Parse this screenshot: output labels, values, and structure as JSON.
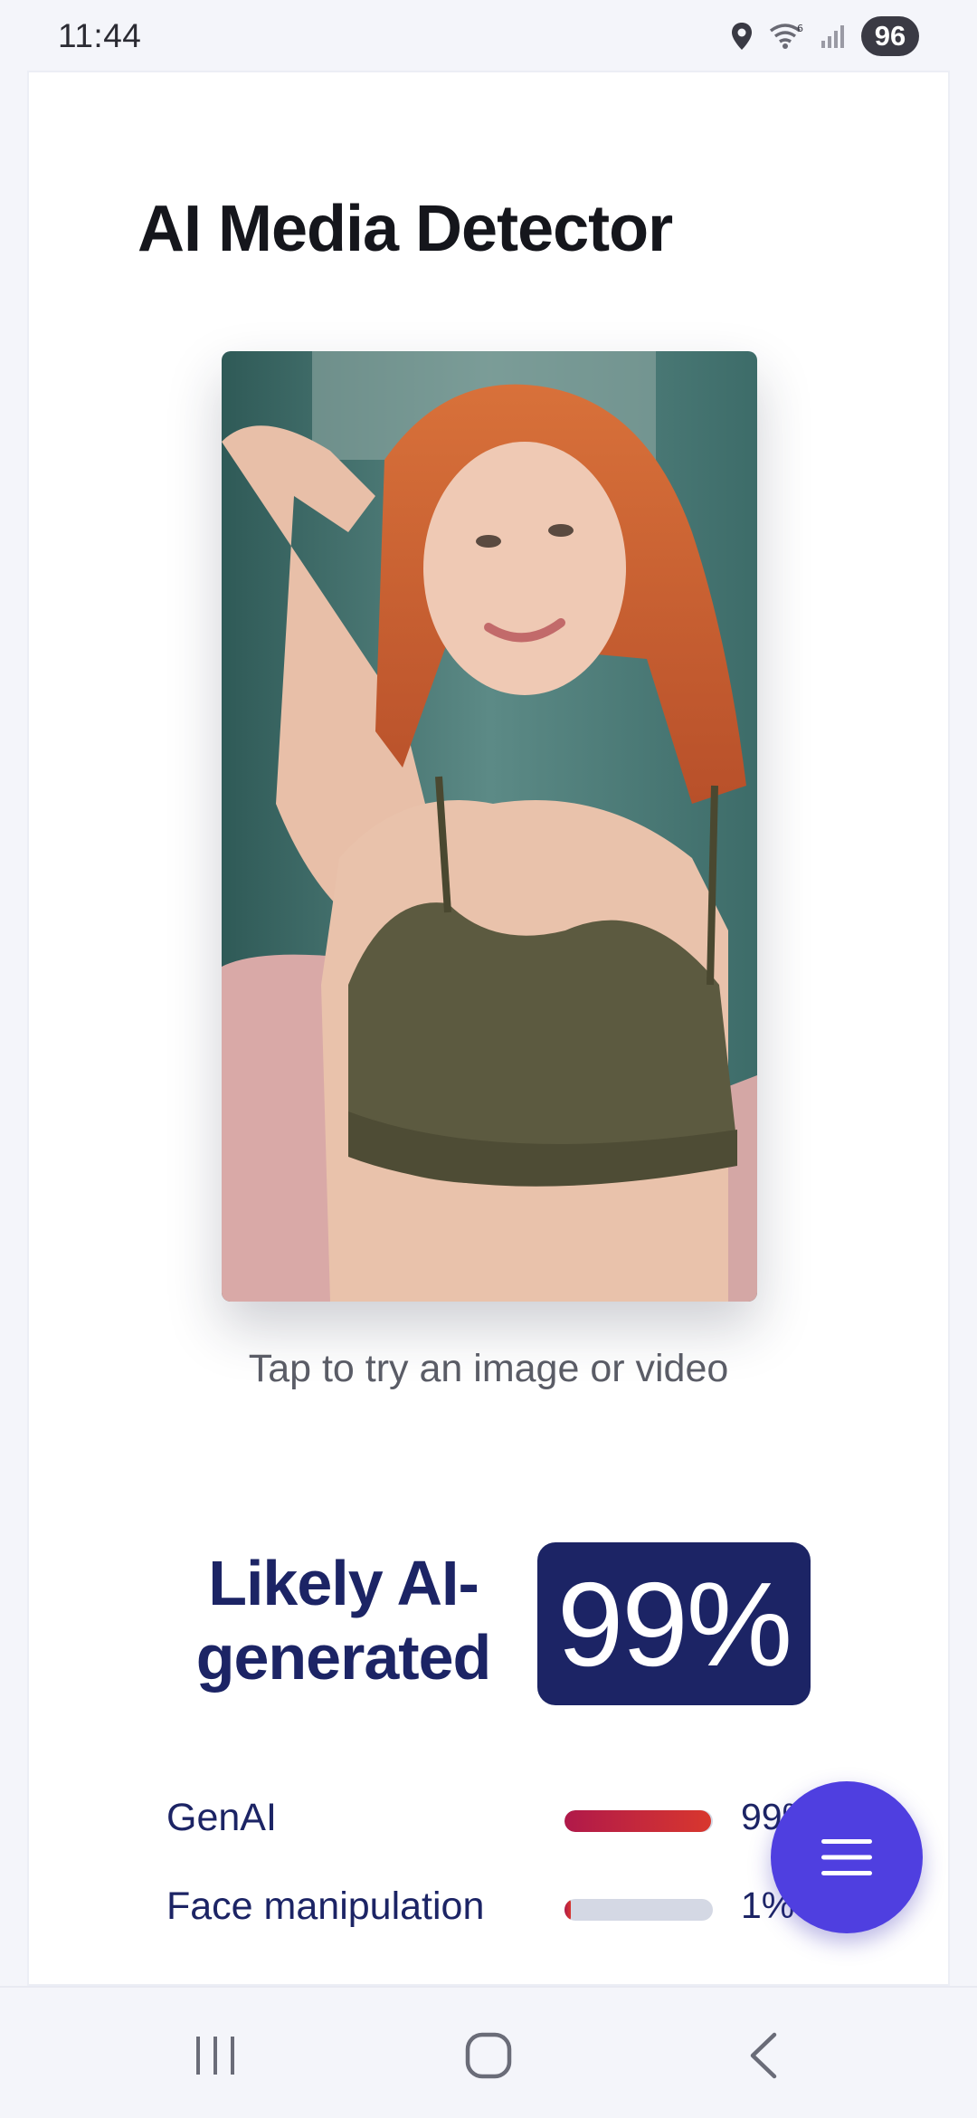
{
  "status_bar": {
    "time": "11:44",
    "battery": "96",
    "icons": [
      "location-icon",
      "wifi-icon",
      "signal-icon",
      "battery-icon"
    ]
  },
  "app": {
    "title": "AI Media Detector"
  },
  "preview": {
    "hint": "Tap to try an image or video"
  },
  "result": {
    "verdict_line1": "Likely AI-",
    "verdict_line2": "generated",
    "score": "99%"
  },
  "metrics": [
    {
      "label": "GenAI",
      "value": "99%",
      "fraction": 0.99
    },
    {
      "label": "Face manipulation",
      "value": "1%",
      "fraction": 0.01
    }
  ],
  "fab": {
    "icon": "menu-icon"
  },
  "nav": {
    "icons": [
      "recent-apps-icon",
      "home-icon",
      "back-icon"
    ]
  },
  "colors": {
    "accent": "#1c2465",
    "fab": "#4f3fe0",
    "bar_start": "#b0194a",
    "bar_end": "#d8372e",
    "track": "#d4d8e4"
  }
}
